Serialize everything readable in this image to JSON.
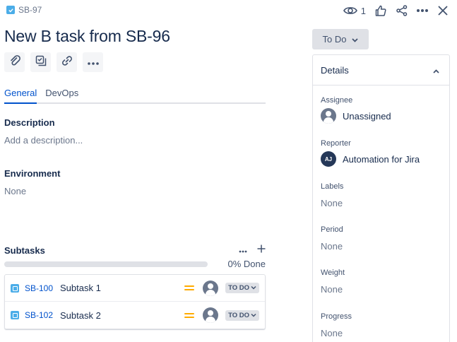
{
  "header": {
    "issue_key": "SB-97",
    "watch_count": "1"
  },
  "issue": {
    "title": "New B task from SB-96",
    "status": "To Do"
  },
  "tabs": [
    {
      "label": "General",
      "active": true
    },
    {
      "label": "DevOps",
      "active": false
    }
  ],
  "description": {
    "label": "Description",
    "placeholder": "Add a description..."
  },
  "environment": {
    "label": "Environment",
    "value": "None"
  },
  "subtasks": {
    "label": "Subtasks",
    "progress_text": "0% Done",
    "progress": 0,
    "items": [
      {
        "key": "SB-100",
        "summary": "Subtask 1",
        "status": "TO DO",
        "priority": "medium"
      },
      {
        "key": "SB-102",
        "summary": "Subtask 2",
        "status": "TO DO",
        "priority": "medium"
      }
    ]
  },
  "details": {
    "title": "Details",
    "assignee": {
      "label": "Assignee",
      "value": "Unassigned"
    },
    "reporter": {
      "label": "Reporter",
      "value": "Automation for Jira",
      "initials": "AJ"
    },
    "labels": {
      "label": "Labels",
      "value": "None"
    },
    "period": {
      "label": "Period",
      "value": "None"
    },
    "weight": {
      "label": "Weight",
      "value": "None"
    },
    "progress": {
      "label": "Progress",
      "value": "None"
    }
  },
  "colors": {
    "accent": "#0052cc",
    "task_icon": "#4bade8",
    "priority_medium": "#ffab00"
  },
  "icons": [
    "checkbox-icon",
    "eye-icon",
    "thumbs-up-icon",
    "share-icon",
    "more-icon",
    "close-icon",
    "paperclip-icon",
    "subtask-icon",
    "link-icon",
    "chevron-down-icon",
    "chevron-up-icon",
    "plus-icon",
    "priority-medium-icon",
    "avatar-icon"
  ]
}
